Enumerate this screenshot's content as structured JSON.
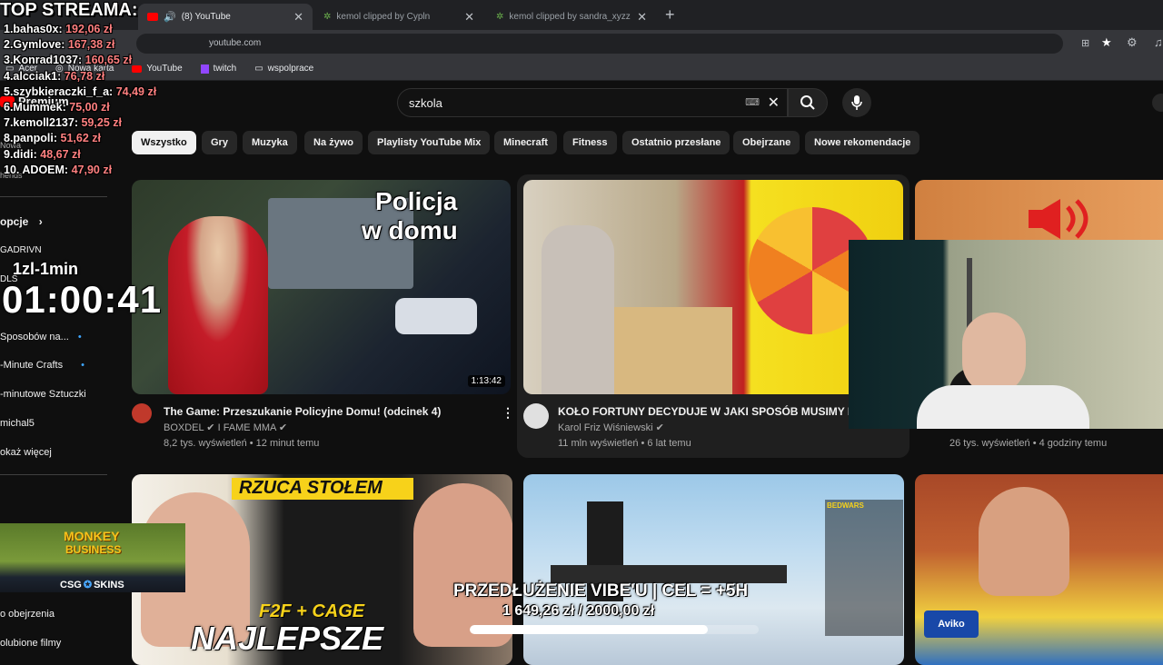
{
  "browser": {
    "tabs": [
      {
        "label": "(8) YouTube"
      },
      {
        "label": "kemol clipped by Cypln"
      },
      {
        "label": "kemol clipped by sandra_xyzz"
      }
    ],
    "url": "youtube.com",
    "bookmarks": [
      "Acer",
      "Nowa karta",
      "YouTube",
      "twitch",
      "wspolprace"
    ]
  },
  "youtube": {
    "search_value": "szkola",
    "premium_label": "Premium",
    "chips": [
      "Wszystko",
      "Gry",
      "Muzyka",
      "Na żywo",
      "Playlisty YouTube Mix",
      "Minecraft",
      "Fitness",
      "Ostatnio przesłane",
      "Obejrzane",
      "Nowe rekomendacje"
    ],
    "sidebar": {
      "items": [
        "Nowa",
        "hends",
        "opcje",
        "GADRIVN",
        "DLS",
        "Sposobów na...",
        "-Minute Crafts",
        "-minutowe Sztuczki",
        "michal5",
        "okaż więcej",
        "o obejrzenia",
        "olubione filmy"
      ]
    },
    "videos": [
      {
        "title": "The Game: Przeszukanie Policyjne Domu! (odcinek 4)",
        "channel": "BOXDEL",
        "channel2": "I FAME MMA",
        "meta": "8,2 tys. wyświetleń • 12 minut temu",
        "duration": "1:13:42",
        "thumb_text_1": "Policja",
        "thumb_text_2": "w domu"
      },
      {
        "title": "KOŁO FORTUNY DECYDUJE W JAKI SPOSÓB MUSIMY M",
        "channel": "Karol Friz Wiśniewski",
        "meta": "11 mln wyświetleń • 6 lat temu"
      },
      {
        "title": "",
        "channel": "",
        "meta": "26 tys. wyświetleń • 4 godziny temu"
      },
      {
        "thumb_text_1": "RZUCA STOŁEM",
        "thumb_text_2": "F2F + CAGE",
        "thumb_text_3": "NAJLEPSZE"
      },
      {
        "thumb_text_1": "BEDWARS"
      },
      {
        "thumb_text_1": "Aviko"
      }
    ]
  },
  "stream_overlay": {
    "title": "TOP STREAMA:",
    "ranking": [
      {
        "name": "1.bahas0x:",
        "amount": "192,06 zł"
      },
      {
        "name": "2.Gymlove:",
        "amount": "167,38 zł"
      },
      {
        "name": "3.Konrad1037:",
        "amount": "160,65 zł"
      },
      {
        "name": "4.alcciak1:",
        "amount": "76,78 zł"
      },
      {
        "name": "5.szybkieraczki_f_a:",
        "amount": "74,49 zł"
      },
      {
        "name": "6.Mummek:",
        "amount": "75,00 zł"
      },
      {
        "name": "7.kemoll2137:",
        "amount": "59,25 zł"
      },
      {
        "name": "8.panpoli:",
        "amount": "51,62 zł"
      },
      {
        "name": "9.didi:",
        "amount": "48,67 zł"
      },
      {
        "name": "10. ADOEM:",
        "amount": "47,90 zł"
      }
    ],
    "timer_label": "1zl-1min",
    "timer": "01:00:41",
    "goal_title": "PRZEDŁUŻENIE VIBE'U | CEL = +5H",
    "goal_current": "1 649,26 zł",
    "goal_target": "2000,00 zł",
    "goal_progress": 0.825,
    "ad_text_1": "MONKEY",
    "ad_text_2": "BUSINESS",
    "ad_brand": "CSG",
    "ad_brand2": "SKINS"
  }
}
